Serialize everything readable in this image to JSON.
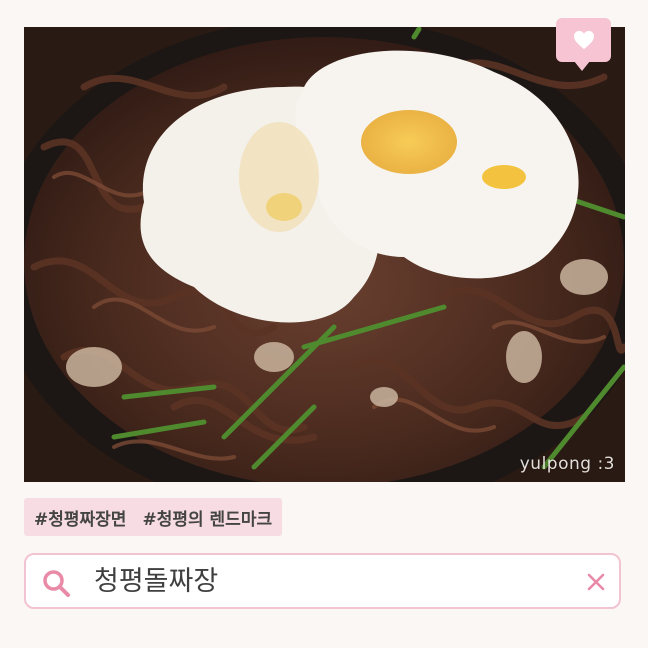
{
  "photo": {
    "subject": "jjajang noodles with two fried eggs on a hot stone plate",
    "watermark": "yulpong :3"
  },
  "badge": {
    "icon": "heart-icon"
  },
  "hashtags": [
    "#청평짜장면",
    "#청평의 렌드마크"
  ],
  "search": {
    "query": "청평돌짜장",
    "icon": "search-icon",
    "clear_icon": "close-icon"
  },
  "colors": {
    "accent": "#f2c3d0",
    "badge": "#f6c4d3",
    "tag_bg": "#f7dde3",
    "icon": "#e98aa7"
  }
}
